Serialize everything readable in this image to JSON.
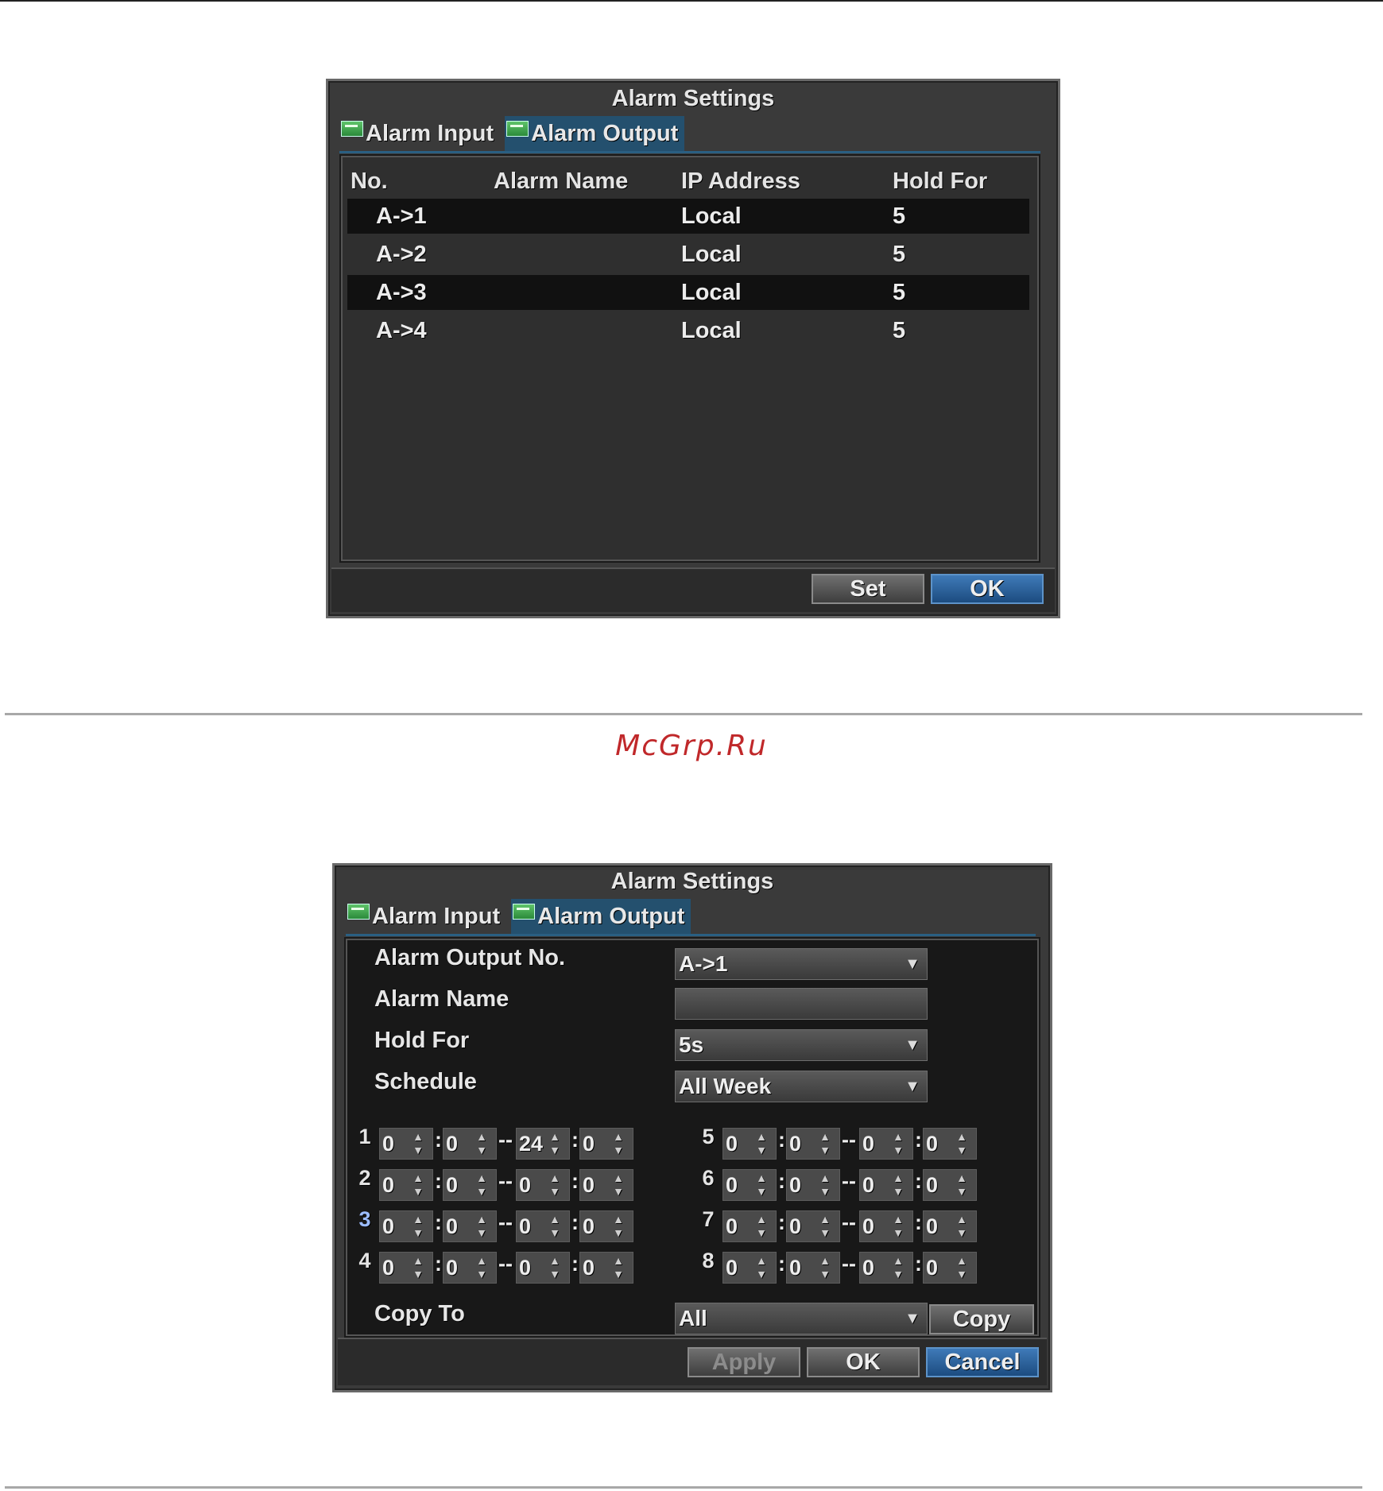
{
  "dialog1": {
    "title": "Alarm Settings",
    "tabs": [
      "Alarm Input",
      "Alarm Output"
    ],
    "columns": [
      "No.",
      "Alarm Name",
      "IP Address",
      "Hold For"
    ],
    "rows": [
      {
        "no": "A->1",
        "name": "",
        "ip": "Local",
        "hold": "5"
      },
      {
        "no": "A->2",
        "name": "",
        "ip": "Local",
        "hold": "5"
      },
      {
        "no": "A->3",
        "name": "",
        "ip": "Local",
        "hold": "5"
      },
      {
        "no": "A->4",
        "name": "",
        "ip": "Local",
        "hold": "5"
      }
    ],
    "set_label": "Set",
    "ok_label": "OK"
  },
  "watermark": "McGrp.Ru",
  "dialog2": {
    "title": "Alarm Settings",
    "tabs": [
      "Alarm Input",
      "Alarm Output"
    ],
    "labels": {
      "output_no": "Alarm Output No.",
      "alarm_name": "Alarm Name",
      "hold_for": "Hold For",
      "schedule": "Schedule",
      "copy_to": "Copy To"
    },
    "values": {
      "output_no": "A->1",
      "alarm_name": "",
      "hold_for": "5s",
      "schedule": "All Week",
      "copy_to": "All"
    },
    "periods": [
      {
        "n": "1",
        "sh": "0",
        "sm": "0",
        "eh": "24",
        "em": "0"
      },
      {
        "n": "2",
        "sh": "0",
        "sm": "0",
        "eh": "0",
        "em": "0"
      },
      {
        "n": "3",
        "sh": "0",
        "sm": "0",
        "eh": "0",
        "em": "0"
      },
      {
        "n": "4",
        "sh": "0",
        "sm": "0",
        "eh": "0",
        "em": "0"
      },
      {
        "n": "5",
        "sh": "0",
        "sm": "0",
        "eh": "0",
        "em": "0"
      },
      {
        "n": "6",
        "sh": "0",
        "sm": "0",
        "eh": "0",
        "em": "0"
      },
      {
        "n": "7",
        "sh": "0",
        "sm": "0",
        "eh": "0",
        "em": "0"
      },
      {
        "n": "8",
        "sh": "0",
        "sm": "0",
        "eh": "0",
        "em": "0"
      }
    ],
    "copy_label": "Copy",
    "apply_label": "Apply",
    "ok_label": "OK",
    "cancel_label": "Cancel"
  }
}
